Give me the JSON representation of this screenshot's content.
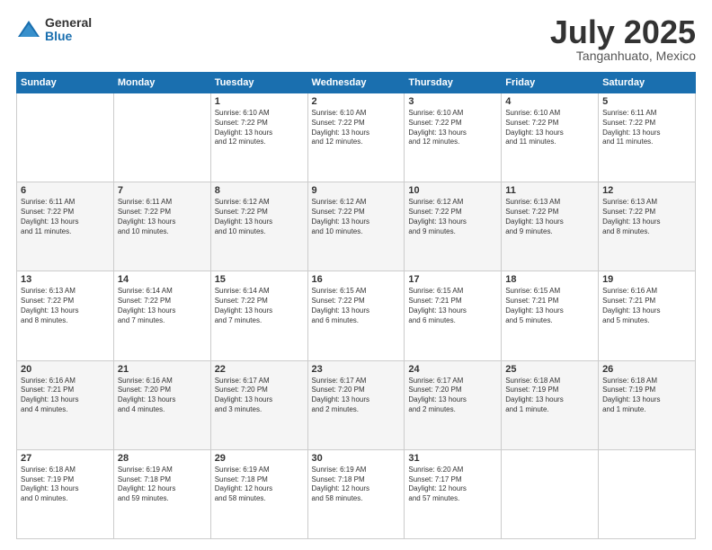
{
  "logo": {
    "general": "General",
    "blue": "Blue"
  },
  "header": {
    "month": "July 2025",
    "location": "Tanganhuato, Mexico"
  },
  "weekdays": [
    "Sunday",
    "Monday",
    "Tuesday",
    "Wednesday",
    "Thursday",
    "Friday",
    "Saturday"
  ],
  "weeks": [
    [
      {
        "day": "",
        "info": ""
      },
      {
        "day": "",
        "info": ""
      },
      {
        "day": "1",
        "info": "Sunrise: 6:10 AM\nSunset: 7:22 PM\nDaylight: 13 hours\nand 12 minutes."
      },
      {
        "day": "2",
        "info": "Sunrise: 6:10 AM\nSunset: 7:22 PM\nDaylight: 13 hours\nand 12 minutes."
      },
      {
        "day": "3",
        "info": "Sunrise: 6:10 AM\nSunset: 7:22 PM\nDaylight: 13 hours\nand 12 minutes."
      },
      {
        "day": "4",
        "info": "Sunrise: 6:10 AM\nSunset: 7:22 PM\nDaylight: 13 hours\nand 11 minutes."
      },
      {
        "day": "5",
        "info": "Sunrise: 6:11 AM\nSunset: 7:22 PM\nDaylight: 13 hours\nand 11 minutes."
      }
    ],
    [
      {
        "day": "6",
        "info": "Sunrise: 6:11 AM\nSunset: 7:22 PM\nDaylight: 13 hours\nand 11 minutes."
      },
      {
        "day": "7",
        "info": "Sunrise: 6:11 AM\nSunset: 7:22 PM\nDaylight: 13 hours\nand 10 minutes."
      },
      {
        "day": "8",
        "info": "Sunrise: 6:12 AM\nSunset: 7:22 PM\nDaylight: 13 hours\nand 10 minutes."
      },
      {
        "day": "9",
        "info": "Sunrise: 6:12 AM\nSunset: 7:22 PM\nDaylight: 13 hours\nand 10 minutes."
      },
      {
        "day": "10",
        "info": "Sunrise: 6:12 AM\nSunset: 7:22 PM\nDaylight: 13 hours\nand 9 minutes."
      },
      {
        "day": "11",
        "info": "Sunrise: 6:13 AM\nSunset: 7:22 PM\nDaylight: 13 hours\nand 9 minutes."
      },
      {
        "day": "12",
        "info": "Sunrise: 6:13 AM\nSunset: 7:22 PM\nDaylight: 13 hours\nand 8 minutes."
      }
    ],
    [
      {
        "day": "13",
        "info": "Sunrise: 6:13 AM\nSunset: 7:22 PM\nDaylight: 13 hours\nand 8 minutes."
      },
      {
        "day": "14",
        "info": "Sunrise: 6:14 AM\nSunset: 7:22 PM\nDaylight: 13 hours\nand 7 minutes."
      },
      {
        "day": "15",
        "info": "Sunrise: 6:14 AM\nSunset: 7:22 PM\nDaylight: 13 hours\nand 7 minutes."
      },
      {
        "day": "16",
        "info": "Sunrise: 6:15 AM\nSunset: 7:22 PM\nDaylight: 13 hours\nand 6 minutes."
      },
      {
        "day": "17",
        "info": "Sunrise: 6:15 AM\nSunset: 7:21 PM\nDaylight: 13 hours\nand 6 minutes."
      },
      {
        "day": "18",
        "info": "Sunrise: 6:15 AM\nSunset: 7:21 PM\nDaylight: 13 hours\nand 5 minutes."
      },
      {
        "day": "19",
        "info": "Sunrise: 6:16 AM\nSunset: 7:21 PM\nDaylight: 13 hours\nand 5 minutes."
      }
    ],
    [
      {
        "day": "20",
        "info": "Sunrise: 6:16 AM\nSunset: 7:21 PM\nDaylight: 13 hours\nand 4 minutes."
      },
      {
        "day": "21",
        "info": "Sunrise: 6:16 AM\nSunset: 7:20 PM\nDaylight: 13 hours\nand 4 minutes."
      },
      {
        "day": "22",
        "info": "Sunrise: 6:17 AM\nSunset: 7:20 PM\nDaylight: 13 hours\nand 3 minutes."
      },
      {
        "day": "23",
        "info": "Sunrise: 6:17 AM\nSunset: 7:20 PM\nDaylight: 13 hours\nand 2 minutes."
      },
      {
        "day": "24",
        "info": "Sunrise: 6:17 AM\nSunset: 7:20 PM\nDaylight: 13 hours\nand 2 minutes."
      },
      {
        "day": "25",
        "info": "Sunrise: 6:18 AM\nSunset: 7:19 PM\nDaylight: 13 hours\nand 1 minute."
      },
      {
        "day": "26",
        "info": "Sunrise: 6:18 AM\nSunset: 7:19 PM\nDaylight: 13 hours\nand 1 minute."
      }
    ],
    [
      {
        "day": "27",
        "info": "Sunrise: 6:18 AM\nSunset: 7:19 PM\nDaylight: 13 hours\nand 0 minutes."
      },
      {
        "day": "28",
        "info": "Sunrise: 6:19 AM\nSunset: 7:18 PM\nDaylight: 12 hours\nand 59 minutes."
      },
      {
        "day": "29",
        "info": "Sunrise: 6:19 AM\nSunset: 7:18 PM\nDaylight: 12 hours\nand 58 minutes."
      },
      {
        "day": "30",
        "info": "Sunrise: 6:19 AM\nSunset: 7:18 PM\nDaylight: 12 hours\nand 58 minutes."
      },
      {
        "day": "31",
        "info": "Sunrise: 6:20 AM\nSunset: 7:17 PM\nDaylight: 12 hours\nand 57 minutes."
      },
      {
        "day": "",
        "info": ""
      },
      {
        "day": "",
        "info": ""
      }
    ]
  ]
}
